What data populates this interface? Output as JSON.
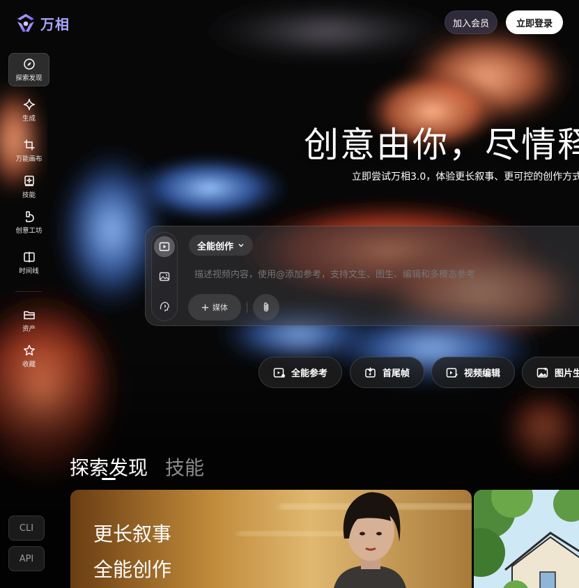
{
  "app": {
    "name": "万相",
    "brand_color": "#a9a6ff"
  },
  "header": {
    "member_label": "加入会员",
    "login_label": "立即登录"
  },
  "sidebar": {
    "items": [
      {
        "label": "探索发现",
        "icon": "compass-icon",
        "active": true
      },
      {
        "label": "生成",
        "icon": "sparkle-icon"
      },
      {
        "label": "万能画布",
        "icon": "crop-icon"
      },
      {
        "label": "技能",
        "icon": "skill-book-icon"
      },
      {
        "label": "创意工坊",
        "icon": "workshop-icon"
      },
      {
        "label": "时间线",
        "icon": "timeline-icon"
      },
      {
        "label": "资产",
        "icon": "folder-icon"
      },
      {
        "label": "收藏",
        "icon": "star-icon"
      }
    ],
    "bottom": {
      "cli_label": "CLI",
      "api_label": "API"
    }
  },
  "hero": {
    "title": "创意由你，尽情释",
    "subtitle": "立即尝试万相3.0，体验更长叙事、更可控的创作方式"
  },
  "composer": {
    "modes": [
      "video-mode-icon",
      "image-mode-icon",
      "avatar-mode-icon"
    ],
    "mode_select": "全能创作",
    "placeholder": "描述视频内容，使用@添加参考，支持文生、图生、编辑和多模态参考",
    "media_label": "媒体"
  },
  "chips": [
    {
      "label": "全能参考",
      "icon": "reference-icon"
    },
    {
      "label": "首尾帧",
      "icon": "first-last-frame-icon"
    },
    {
      "label": "视频编辑",
      "icon": "video-edit-icon"
    },
    {
      "label": "图片生",
      "icon": "image-gen-icon"
    }
  ],
  "explore": {
    "tabs": [
      "探索发现",
      "技能"
    ],
    "card1": {
      "lines": [
        "更长叙事",
        "全能创作"
      ]
    }
  }
}
